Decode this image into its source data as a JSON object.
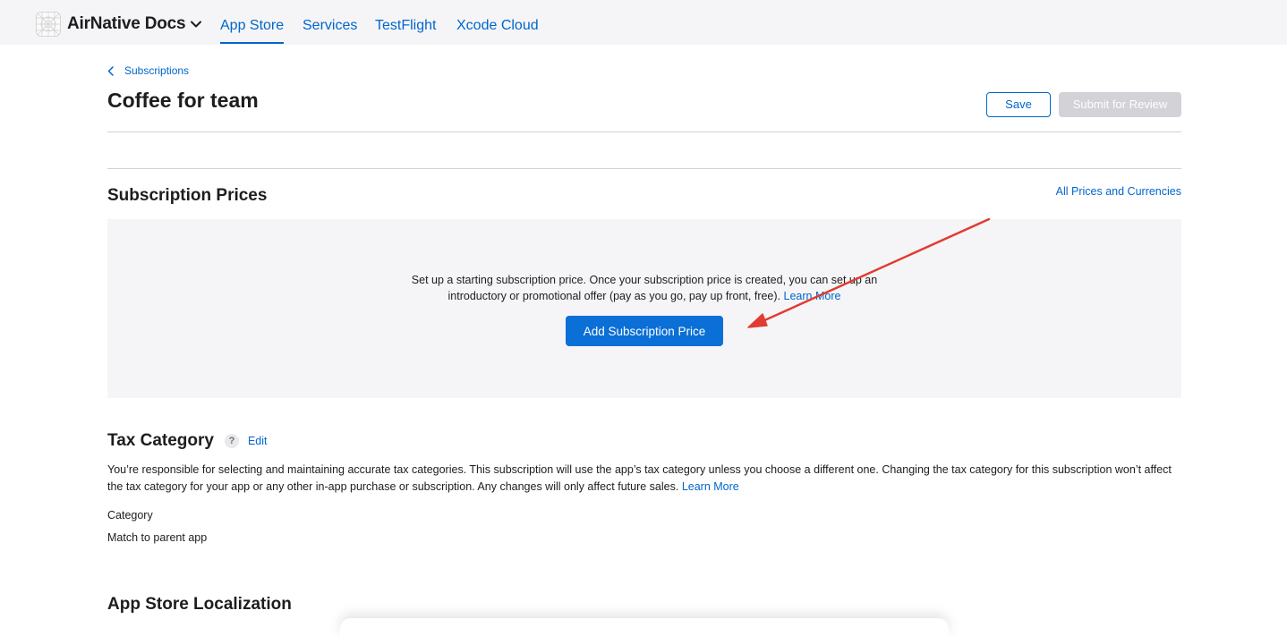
{
  "header": {
    "brand_name": "AirNative Docs",
    "tabs": [
      {
        "label": "App Store",
        "active": true
      },
      {
        "label": "Services",
        "active": false
      },
      {
        "label": "TestFlight",
        "active": false
      },
      {
        "label": "Xcode Cloud",
        "active": false
      }
    ]
  },
  "page": {
    "back_label": "Subscriptions",
    "title": "Coffee for team",
    "save_label": "Save",
    "submit_label": "Submit for Review"
  },
  "prices": {
    "title": "Subscription Prices",
    "all_prices_link": "All Prices and Currencies",
    "empty_text_line1": "Set up a starting subscription price. Once your subscription price is created, you can set up an",
    "empty_text_line2": "introductory or promotional offer (pay as you go, pay up front, free).",
    "learn_more": "Learn More",
    "add_button": "Add Subscription Price"
  },
  "tax": {
    "title": "Tax Category",
    "help_glyph": "?",
    "edit_link": "Edit",
    "description": "You’re responsible for selecting and maintaining accurate tax categories. This subscription will use the app’s tax category unless you choose a different one. Changing the tax category for this subscription won’t affect the tax category for your app or any other in-app purchase or subscription. Any changes will only affect future sales.",
    "learn_more": "Learn More",
    "category_label": "Category",
    "category_value": "Match to parent app"
  },
  "localization": {
    "title": "App Store Localization"
  },
  "colors": {
    "accent": "#0066cc",
    "primary_button": "#0a6fd6",
    "disabled_button": "#d2d2d7",
    "annotation_arrow": "#e03c31",
    "panel_background": "#f5f5f7"
  }
}
